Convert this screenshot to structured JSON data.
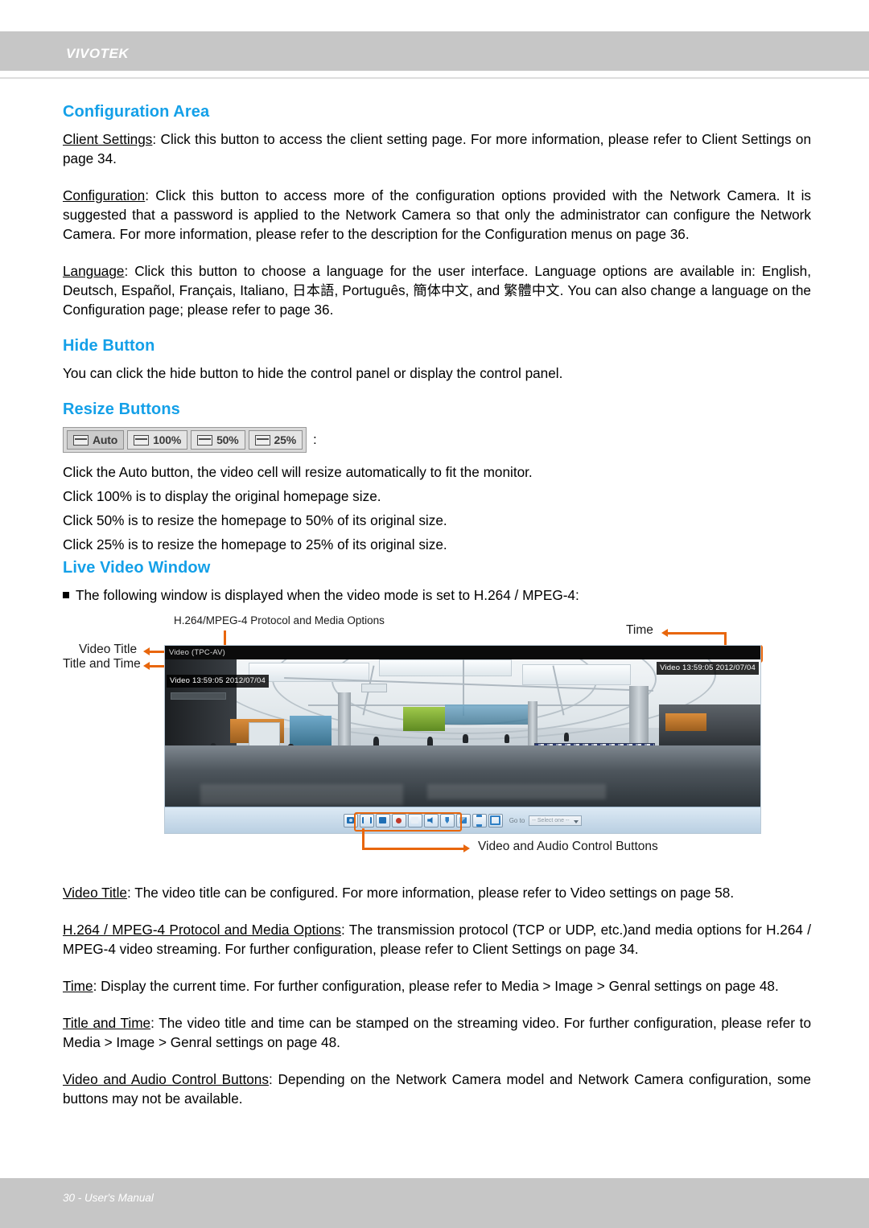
{
  "header": {
    "brand": "VIVOTEK"
  },
  "sections": {
    "configuration_area": {
      "heading": "Configuration Area",
      "paragraphs": [
        {
          "lead": "Client Settings",
          "text": ": Click this button to access the client setting page. For more information, please refer to Client Settings on page 34."
        },
        {
          "lead": "Configuration",
          "text": ": Click this button to access more of the configuration options provided with the Network Camera. It is suggested that a password is applied to the Network Camera so that only the administrator can configure the Network Camera. For more information, please refer to the description for the Configuration menus on page 36."
        },
        {
          "lead": "Language",
          "text": ": Click this button to choose a language for the user interface. Language options are available in: English, Deutsch, Español, Français, Italiano, 日本語, Português, 簡体中文, and 繁體中文. You can also change a language on the Configuration page; please refer to page 36."
        }
      ]
    },
    "hide_button": {
      "heading": "Hide Button",
      "text": "You can click the hide button to hide the control panel or display the control panel."
    },
    "resize_buttons": {
      "heading": "Resize Buttons",
      "buttons": [
        {
          "label": "Auto",
          "icon": "resize-icon"
        },
        {
          "label": "100%",
          "icon": "resize-icon"
        },
        {
          "label": "50%",
          "icon": "resize-icon"
        },
        {
          "label": "25%",
          "icon": "resize-icon"
        }
      ],
      "trailing_colon": ":",
      "lines": [
        "Click the Auto button, the video cell will resize automatically to fit the monitor.",
        "Click 100% is to display the original homepage size.",
        "Click 50% is to resize the homepage to 50% of its original size.",
        "Click 25% is to resize the homepage to 25% of its original size."
      ]
    },
    "live_video_window": {
      "heading": "Live Video Window",
      "bullet_text": "The following window is displayed when the video mode is set to H.264 / MPEG-4:",
      "figure": {
        "callouts": {
          "protocol": "H.264/MPEG-4 Protocol and Media Options",
          "video_title": "Video Title",
          "title_and_time": "Title and Time",
          "time": "Time",
          "controls": "Video and Audio Control Buttons"
        },
        "window": {
          "titlebar_name": "Video",
          "titlebar_protocol": "(TPC-AV)",
          "overlay_left": "Video 13:59:05  2012/07/04",
          "overlay_right": "Video 13:59:05  2012/07/04",
          "goto_label": "Go to",
          "goto_value": "-- Select one --",
          "control_buttons": [
            "snapshot-button",
            "pause-button",
            "stop-button",
            "record-button",
            "volume-off-button",
            "speaker-button",
            "microphone-button",
            "digital-zoom-button",
            "pan-tilt-button",
            "fullscreen-button"
          ]
        }
      },
      "paragraphs": [
        {
          "lead": "Video Title",
          "text": ": The video title can be configured. For more information, please refer to Video settings on page 58."
        },
        {
          "lead": "H.264 / MPEG-4 Protocol and Media Options",
          "text": ": The transmission protocol (TCP or UDP, etc.)and media options for H.264 / MPEG-4 video streaming. For further configuration, please refer to Client Settings on page 34."
        },
        {
          "lead": "Time",
          "text": ": Display the current time. For further configuration, please refer to Media > Image > Genral settings on page 48."
        },
        {
          "lead": "Title and Time",
          "text": ": The video title and time can be stamped on the streaming video. For further configuration, please refer to Media > Image > Genral settings on page 48."
        },
        {
          "lead": "Video and Audio Control Buttons",
          "text": ": Depending on the Network Camera model and Network Camera configuration, some buttons may not be available."
        }
      ]
    }
  },
  "footer": {
    "text": "30 - User's Manual"
  },
  "colors": {
    "heading_blue": "#14a0e8",
    "band_gray": "#c6c6c6",
    "annotation_orange": "#e8660c"
  }
}
